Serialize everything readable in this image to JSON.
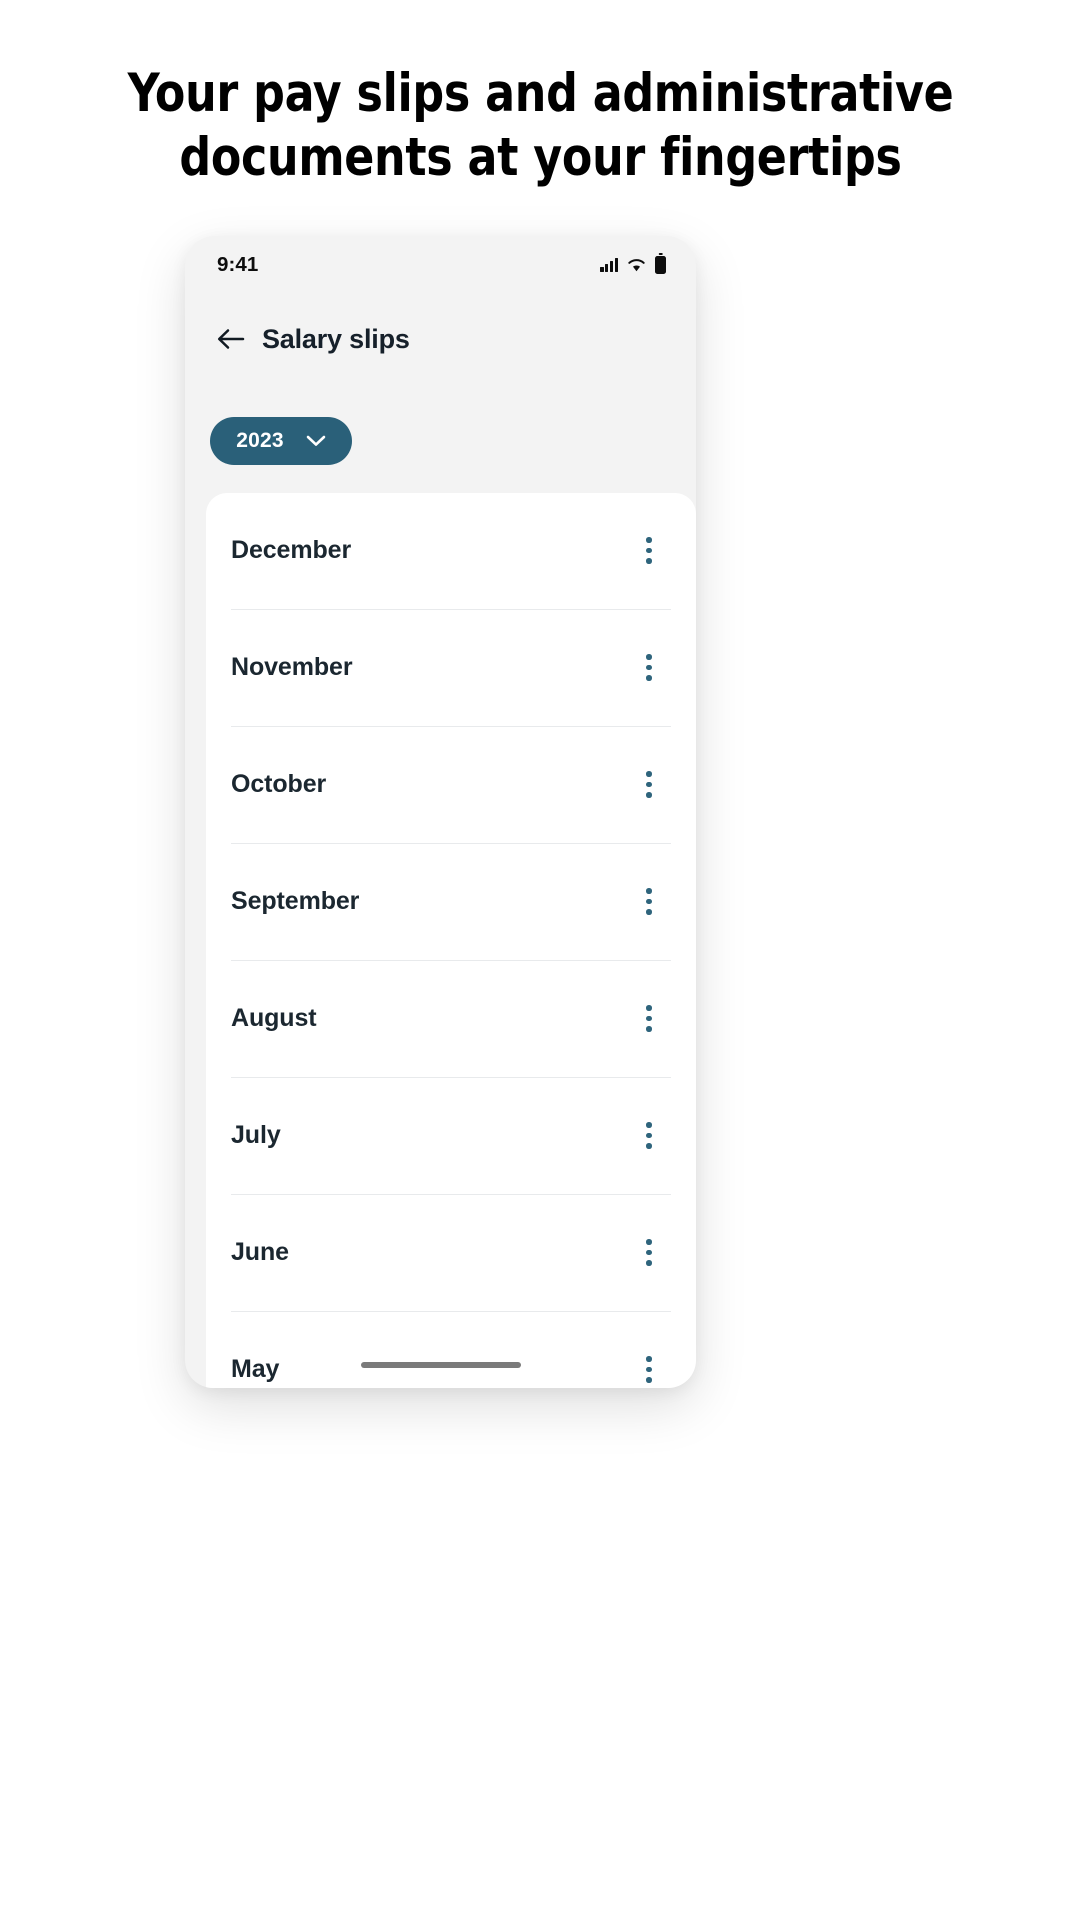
{
  "headline": {
    "line1": "Your pay slips and administrative",
    "line2": "documents at your fingertips"
  },
  "phone": {
    "status_bar": {
      "time": "9:41",
      "signal_icon": "cellular-signal-icon",
      "wifi_icon": "wifi-icon",
      "battery_icon": "battery-icon"
    },
    "app_bar": {
      "back_icon": "back-arrow-icon",
      "title": "Salary slips"
    },
    "year_filter": {
      "label": "2023",
      "chevron_icon": "chevron-down-icon",
      "background_color": "#2a6079",
      "text_color": "#ffffff"
    },
    "list": {
      "kebab_icon": "more-vertical-icon",
      "kebab_color": "#2e647c",
      "rows": [
        {
          "month": "December"
        },
        {
          "month": "November"
        },
        {
          "month": "October"
        },
        {
          "month": "September"
        },
        {
          "month": "August"
        },
        {
          "month": "July"
        },
        {
          "month": "June"
        },
        {
          "month": "May"
        }
      ]
    },
    "home_indicator": "home-indicator-bar"
  },
  "colors": {
    "page_background": "#ffffff",
    "phone_frame": "#f3f3f3",
    "card_background": "#ffffff",
    "accent_teal": "#2a6079",
    "text_primary": "#16202a",
    "divider": "#e8eaec"
  }
}
